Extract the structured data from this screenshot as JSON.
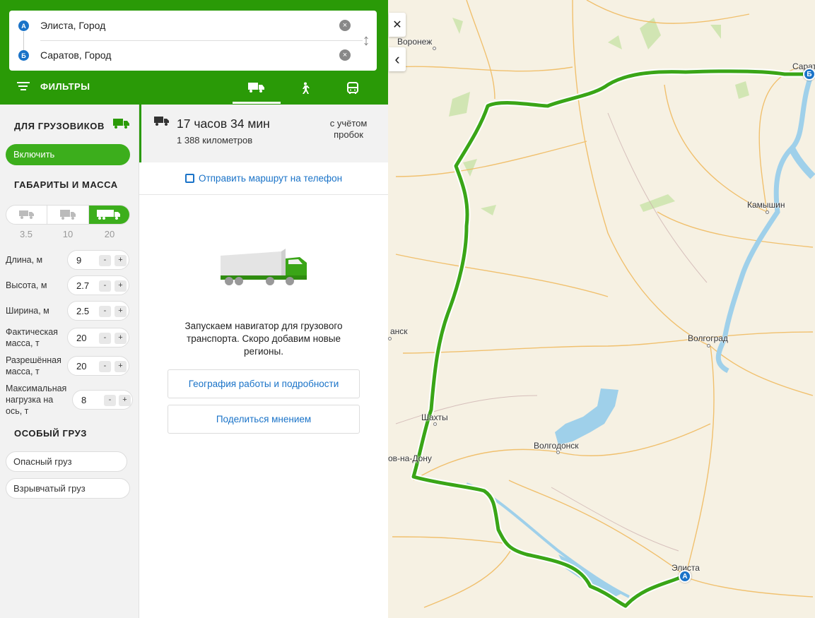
{
  "route": {
    "from": "Элиста, Город",
    "to": "Саратов, Город",
    "from_marker": "А",
    "to_marker": "Б"
  },
  "toolbar": {
    "filters_label": "ФИЛЬТРЫ",
    "modes": [
      "truck",
      "walk",
      "bus"
    ],
    "active_mode": "truck",
    "accent_color": "#2a9a07"
  },
  "trucks": {
    "section_title": "ДЛЯ ГРУЗОВИКОВ",
    "enable_label": "Включить",
    "dims_title": "ГАБАРИТЫ И МАССА",
    "presets": [
      "3.5",
      "10",
      "20"
    ],
    "selected_preset": "20",
    "params": [
      {
        "label": "Длина, м",
        "value": "9"
      },
      {
        "label": "Высота, м",
        "value": "2.7"
      },
      {
        "label": "Ширина, м",
        "value": "2.5"
      },
      {
        "label": "Фактическая масса, т",
        "value": "20"
      },
      {
        "label": "Разрешённая масса, т",
        "value": "20"
      },
      {
        "label": "Максимальная нагрузка на ось, т",
        "value": "8"
      }
    ],
    "minus": "-",
    "plus": "+",
    "special_title": "ОСОБЫЙ ГРУЗ",
    "cargo": [
      "Опасный груз",
      "Взрывчатый груз"
    ]
  },
  "summary": {
    "time": "17 часов 34 мин",
    "distance": "1 388 километров",
    "traffic": "с учётом пробок",
    "send_label": "Отправить маршрут на телефон"
  },
  "promo": {
    "text": "Запускаем навигатор для грузового транспорта. Скоро добавим новые регионы.",
    "geo_button": "География работы и подробности",
    "feedback_button": "Поделиться мнением"
  },
  "map": {
    "close_glyph": "✕",
    "collapse_glyph": "‹",
    "route_color": "#3aa517",
    "cities": [
      "Воронеж",
      "Сарат",
      "Камышин",
      "Волгоград",
      "анск",
      "Шахты",
      "Волгодонск",
      "ов-на-Дону",
      "Элиста"
    ]
  }
}
